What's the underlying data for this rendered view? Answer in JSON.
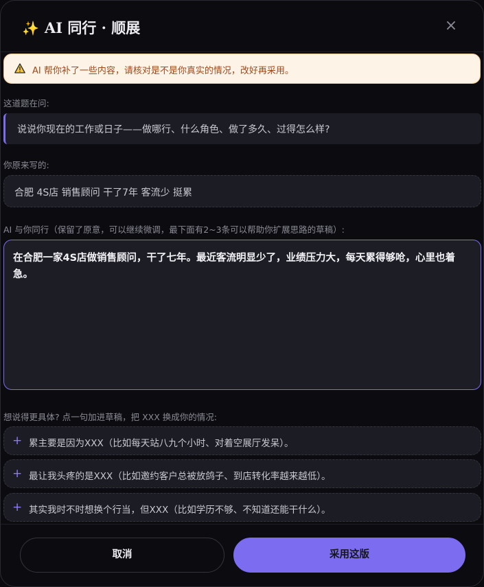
{
  "dialog": {
    "title": "AI 同行 · 顺展",
    "close_label": "×"
  },
  "warning": {
    "text": "AI 帮你补了一些内容，请核对是不是你真实的情况，改好再采用。"
  },
  "question": {
    "label": "这道题在问:",
    "text": "说说你现在的工作或日子——做哪行、什么角色、做了多久、过得怎么样?"
  },
  "original": {
    "label": "你原来写的:",
    "text": "合肥 4S店 销售顾问 干了7年 客流少 挺累"
  },
  "draft": {
    "label": "AI 与你同行（保留了原意，可以继续微调，最下面有2~3条可以帮助你扩展思路的草稿）:",
    "text": "在合肥一家4S店做销售顾问，干了七年。最近客流明显少了，业绩压力大，每天累得够呛，心里也着急。"
  },
  "suggestions": {
    "label": "想说得更具体? 点一句加进草稿，把 XXX 换成你的情况:",
    "items": [
      {
        "plus": "+",
        "text": "累主要是因为XXX（比如每天站八九个小时、对着空展厅发呆）。"
      },
      {
        "plus": "+",
        "text": "最让我头疼的是XXX（比如邀约客户总被放鸽子、到店转化率越来越低）。"
      },
      {
        "plus": "+",
        "text": "其实我时不时想换个行当，但XXX（比如学历不够、不知道还能干什么）。"
      }
    ]
  },
  "footer": {
    "cancel_label": "取消",
    "adopt_label": "采用这版"
  },
  "colors": {
    "accent": "#7c6cf0",
    "warning_bg": "#fdf3e6",
    "warning_text": "#a0481b",
    "sparkle": "#f5c542"
  }
}
